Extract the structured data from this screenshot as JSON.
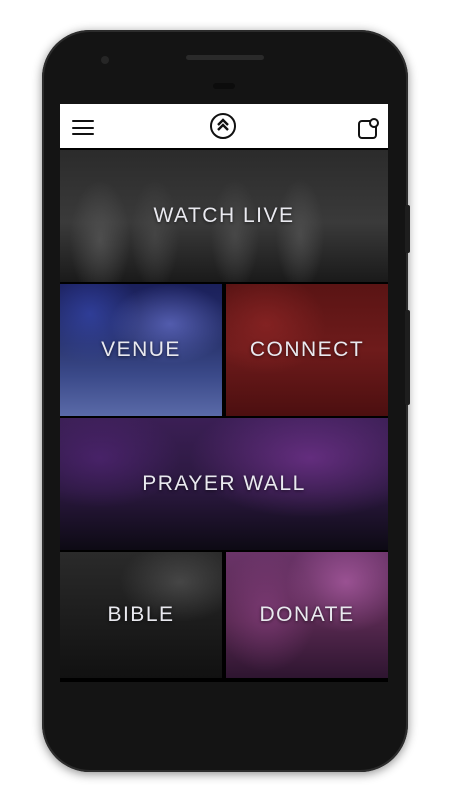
{
  "tiles": {
    "watch_live": "WATCH LIVE",
    "venue": "VENUE",
    "connect": "CONNECT",
    "prayer_wall": "PRAYER WALL",
    "bible": "BIBLE",
    "donate": "DONATE"
  },
  "icons": {
    "menu": "hamburger-menu-icon",
    "logo": "chevron-logo-icon",
    "notifications": "notification-icon"
  },
  "colors": {
    "topbar": "#ffffff",
    "tile_text": "#e9e9ef",
    "phone_frame": "#141414"
  }
}
